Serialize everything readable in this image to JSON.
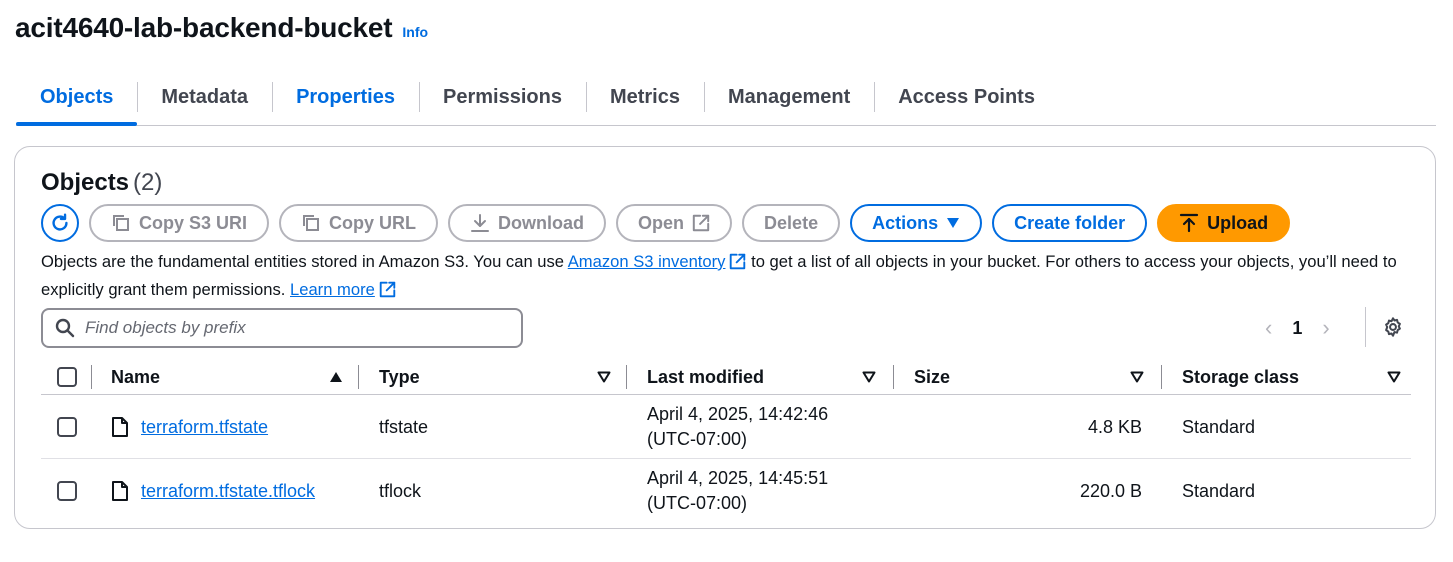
{
  "header": {
    "title": "acit4640-lab-backend-bucket",
    "info_label": "Info"
  },
  "tabs": [
    {
      "label": "Objects",
      "active": true
    },
    {
      "label": "Metadata"
    },
    {
      "label": "Properties"
    },
    {
      "label": "Permissions"
    },
    {
      "label": "Metrics"
    },
    {
      "label": "Management"
    },
    {
      "label": "Access Points"
    }
  ],
  "objects_panel": {
    "title": "Objects",
    "count": "(2)",
    "buttons": {
      "copy_s3_uri": "Copy S3 URI",
      "copy_url": "Copy URL",
      "download": "Download",
      "open": "Open",
      "delete": "Delete",
      "actions": "Actions",
      "create_folder": "Create folder",
      "upload": "Upload"
    },
    "description": {
      "part1": "Objects are the fundamental entities stored in Amazon S3. You can use ",
      "inventory_link": "Amazon S3 inventory",
      "part2": " to get a list of all objects in your bucket. For others to access your objects, you’ll need to explicitly grant them permissions. ",
      "learn_more": "Learn more"
    },
    "search": {
      "placeholder": "Find objects by prefix",
      "value": ""
    },
    "pagination": {
      "current_page": "1"
    },
    "table": {
      "columns": [
        "Name",
        "Type",
        "Last modified",
        "Size",
        "Storage class"
      ],
      "rows": [
        {
          "name": "terraform.tfstate",
          "type": "tfstate",
          "last_modified_date": "April 4, 2025, 14:42:46",
          "last_modified_tz": "(UTC-07:00)",
          "size": "4.8 KB",
          "storage_class": "Standard"
        },
        {
          "name": "terraform.tfstate.tflock",
          "type": "tflock",
          "last_modified_date": "April 4, 2025, 14:45:51",
          "last_modified_tz": "(UTC-07:00)",
          "size": "220.0 B",
          "storage_class": "Standard"
        }
      ]
    }
  },
  "colors": {
    "accent": "#006ce0",
    "upload": "#ff9900",
    "disabled": "#8c8c94"
  }
}
